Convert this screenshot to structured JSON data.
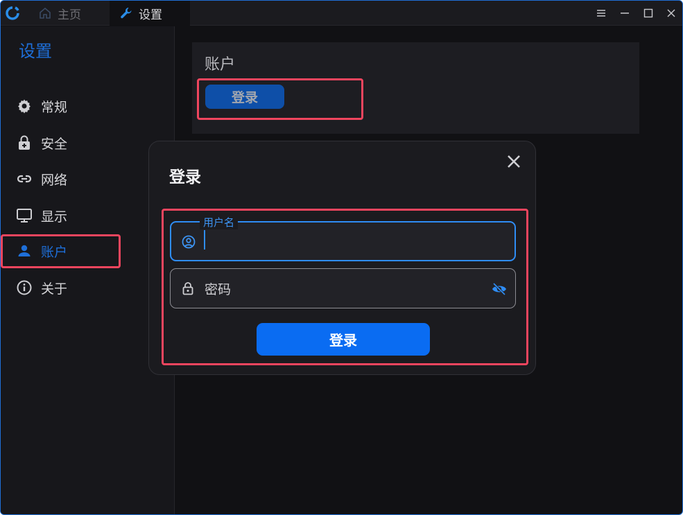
{
  "titlebar": {
    "tabs": [
      {
        "label": "主页",
        "icon": "home-icon"
      },
      {
        "label": "设置",
        "icon": "wrench-icon"
      }
    ],
    "controls": [
      "menu-icon",
      "minimize-icon",
      "maximize-icon",
      "close-icon"
    ]
  },
  "sidebar": {
    "title": "设置",
    "items": [
      {
        "label": "常规",
        "icon": "gear-icon"
      },
      {
        "label": "安全",
        "icon": "lock-plus-icon"
      },
      {
        "label": "网络",
        "icon": "link-icon"
      },
      {
        "label": "显示",
        "icon": "monitor-icon"
      },
      {
        "label": "账户",
        "icon": "person-icon",
        "active": true
      },
      {
        "label": "关于",
        "icon": "info-icon"
      }
    ]
  },
  "main": {
    "card": {
      "title": "账户",
      "login_label": "登录"
    }
  },
  "dialog": {
    "title": "登录",
    "username": {
      "label": "用户名",
      "value": ""
    },
    "password": {
      "placeholder": "密码"
    },
    "submit_label": "登录"
  },
  "colors": {
    "accent": "#1e6fd9",
    "primary_button": "#0a6cf2",
    "highlight": "#f0455e",
    "background": "#111114"
  }
}
